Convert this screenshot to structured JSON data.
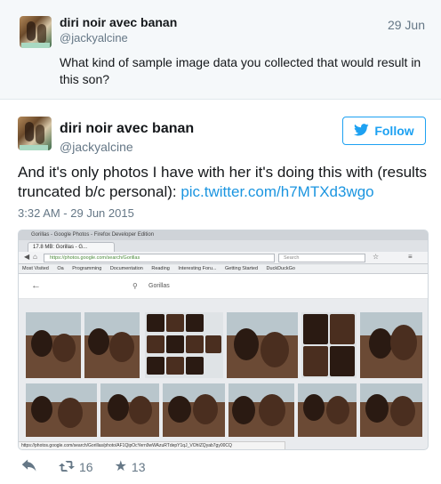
{
  "reply_tweet": {
    "display_name": "diri noir avec banan",
    "handle": "@jackyalcine",
    "date": "29 Jun",
    "text": "What kind of sample image data you collected that would result in this son?"
  },
  "main_tweet": {
    "display_name": "diri noir avec banan",
    "handle": "@jackyalcine",
    "follow_label": "Follow",
    "text_before_link": "And it's only photos I have with her it's doing this with (results truncated b/c personal): ",
    "link_text": "pic.twitter.com/h7MTXd3wgo",
    "timestamp": "3:32 AM - 29 Jun 2015",
    "retweet_count": "16",
    "favorite_count": "13"
  },
  "screenshot": {
    "window_title": "Gorillas - Google Photos - Firefox Developer Edition",
    "tab_label": "17.8 MB: Gorillas - G...",
    "url": "https://photos.google.com/search/Gorillas",
    "search_placeholder": "Search",
    "bookmarks": [
      "Most Visited",
      "Oa",
      "Programming",
      "Documentation",
      "Reading",
      "Interesting Foru...",
      "Getting Started",
      "DuckDuckGo"
    ],
    "search_query": "Gorillas",
    "status_url": "https://photos.google.com/search/Gorillas/photo/AF1QipOcYern9wWAzuRTdepY1qJ_VOhIZQyab7gy00CQ"
  },
  "icons": {
    "twitter_bird": "twitter-bird-icon",
    "reply": "reply-icon",
    "retweet": "retweet-icon",
    "favorite": "star-icon"
  },
  "colors": {
    "accent": "#1da1f2",
    "link": "#1b95e0",
    "muted": "#657786"
  }
}
